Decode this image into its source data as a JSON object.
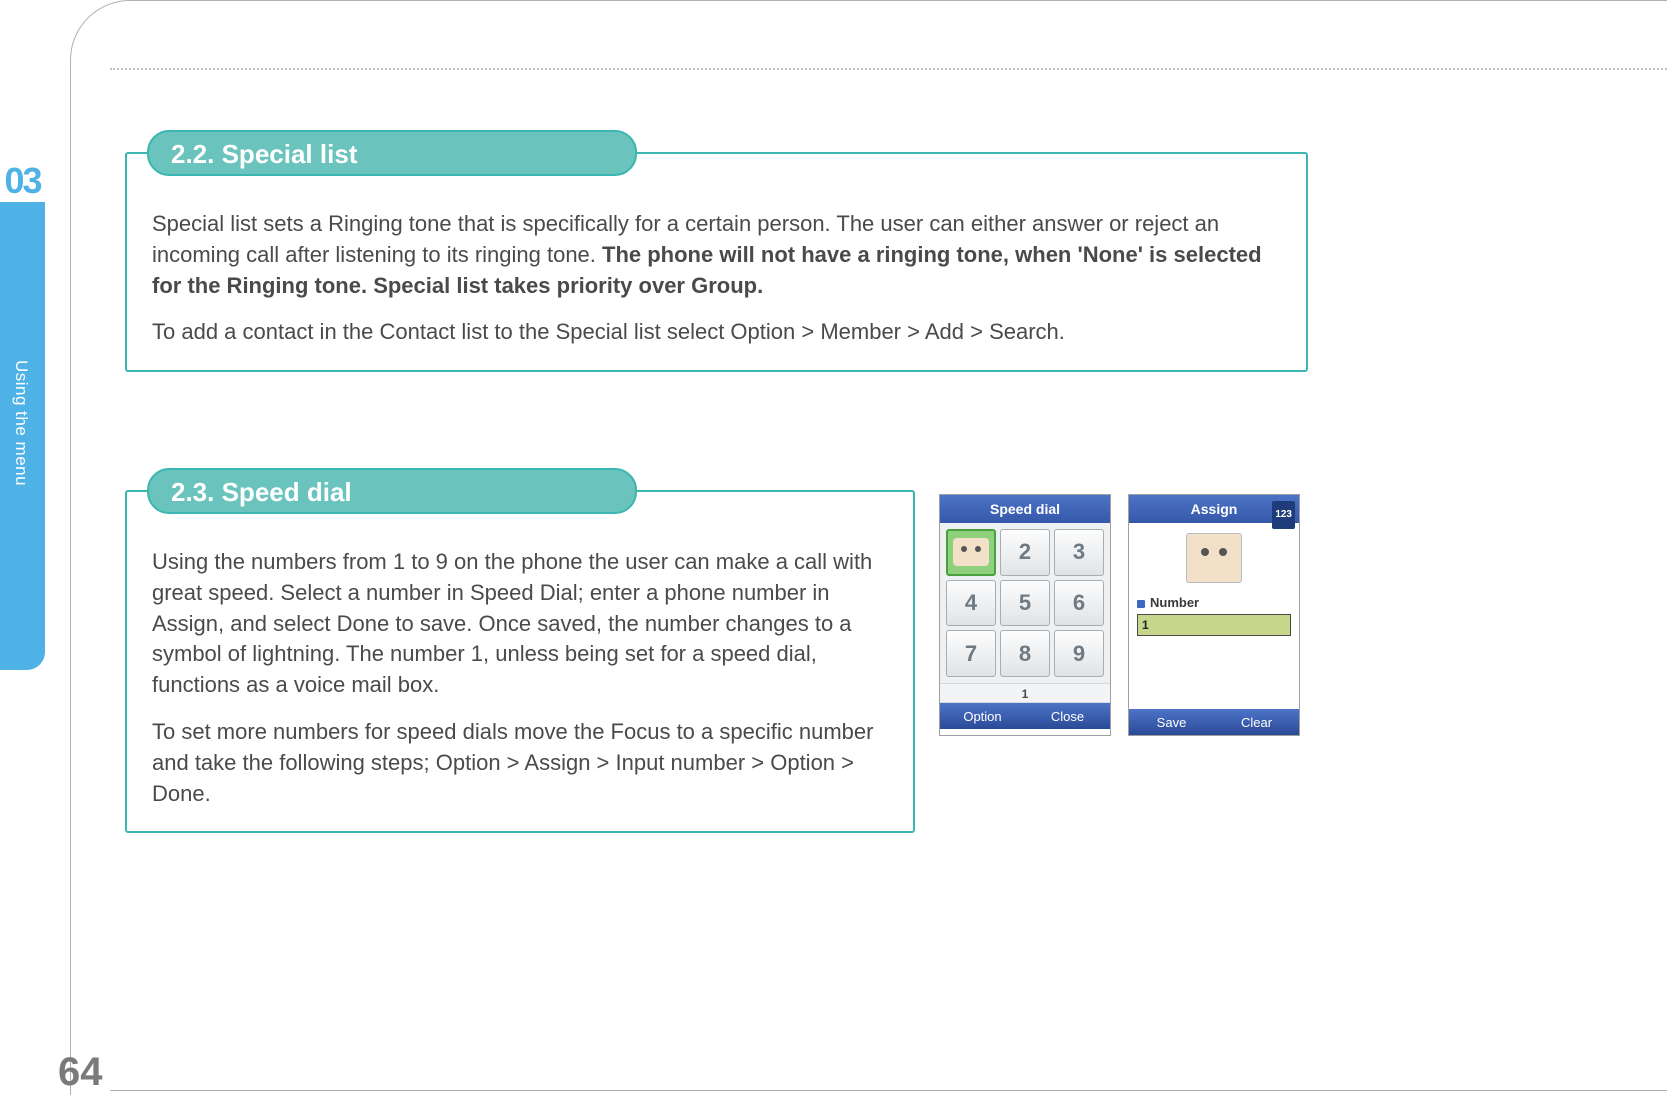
{
  "chapter": {
    "number": "03",
    "label": "Using the menu"
  },
  "page_number": "64",
  "section1": {
    "title": "2.2. Special list",
    "p1_plain": "Special list sets a Ringing tone that is specifically for a certain person. The user can either answer or reject an incoming call after listening to its ringing tone. ",
    "p1_bold": "The phone will not have a ringing tone, when 'None' is selected for the Ringing tone. Special list takes priority over Group.",
    "p2": "To add a contact in the Contact list to the Special list select Option > Member > Add > Search."
  },
  "section2": {
    "title": "2.3. Speed dial",
    "p1": "Using the numbers from 1 to 9 on the phone the user can make a call with great speed. Select a number in Speed Dial; enter a phone number in Assign, and select Done to save. Once saved, the number changes to a symbol of lightning. The number 1, unless being set for a speed dial, functions as a voice mail box.",
    "p2": "To set more numbers for speed dials move the Focus to a specific number and take the following steps; Option > Assign > Input number > Option > Done."
  },
  "phone_speed_dial": {
    "title": "Speed  dial",
    "keys": [
      "",
      "2",
      "3",
      "4",
      "5",
      "6",
      "7",
      "8",
      "9"
    ],
    "status": "1",
    "sk_left": "Option",
    "sk_right": "Close"
  },
  "phone_assign": {
    "title": "Assign",
    "input_mode": "123",
    "field_label": "Number",
    "field_value": "1",
    "sk_left": "Save",
    "sk_right": "Clear"
  }
}
